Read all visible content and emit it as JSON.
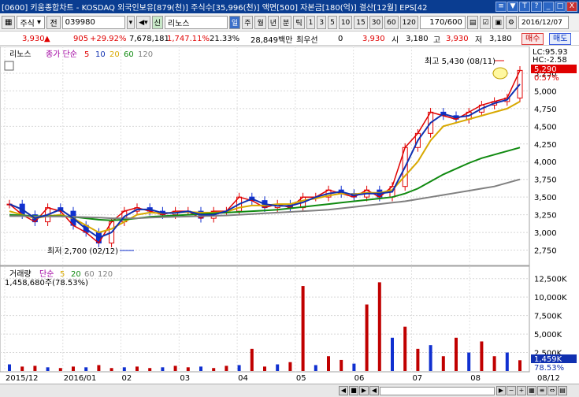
{
  "window": {
    "title": "[0600] 키움종합차트 - KOSDAQ 외국인보유[879(천)] 주식수[35,996(천)] 액면[500] 자본금[180(억)] 결산[12월] EPS[42",
    "buttons": [
      "≡",
      "▼",
      "T",
      "?",
      "_",
      "□",
      "X"
    ]
  },
  "toolbar": {
    "market": "주식",
    "prev_label": "전",
    "code": "039980",
    "stock_name": "리노스",
    "name_prefix": "신",
    "period_tabs": [
      "일",
      "주",
      "월",
      "년",
      "분",
      "틱"
    ],
    "selected_period": "일",
    "minute_options": [
      "1",
      "3",
      "5",
      "10",
      "15",
      "30",
      "60",
      "120"
    ],
    "count": "170",
    "count_total": "/600",
    "date": "2016/12/07"
  },
  "info": {
    "price": "3,930",
    "change": "905",
    "change_pct": "+29.92%",
    "volume": "7,678,181",
    "vol_pct": "1,747.11%",
    "turnover": "21.33%",
    "amount": "28,849백만",
    "min_label": "최우선",
    "min_val": "0",
    "cur": "3,930",
    "open_label": "시",
    "open": "3,180",
    "high_label": "고",
    "high": "3,930",
    "low_label": "저",
    "low": "3,180",
    "buy": "매수",
    "sell": "매도"
  },
  "price_panel": {
    "legend_name": "리노스",
    "legend_ma": "종가 단순",
    "ma_periods": [
      "5",
      "10",
      "20",
      "60",
      "120"
    ],
    "ma_colors": [
      "#e00000",
      "#1030b0",
      "#d8a800",
      "#108a10",
      "#808080"
    ],
    "lc": "LC:95.93",
    "hc": "HC:-2.58",
    "cur_price": "5,290",
    "cur_pct": "0.57%",
    "high_note": "최고 5,430 (08/11)",
    "low_note": "최저 2,700 (02/12)",
    "y_ticks": [
      "5,250",
      "5,000",
      "4,750",
      "4,500",
      "4,250",
      "4,000",
      "3,750",
      "3,500",
      "3,250",
      "3,000",
      "2,750"
    ]
  },
  "volume_panel": {
    "legend_name": "거래량",
    "legend_ma": "단순",
    "ma_periods": [
      "5",
      "20",
      "60",
      "120"
    ],
    "value_line": "1,458,680주(78.53%)",
    "cur_vol": "1,459K",
    "cur_pct": "78.53%",
    "y_ticks": [
      "12,500K",
      "10,000K",
      "7,500K",
      "5,000K",
      "2,500K"
    ]
  },
  "x_axis": {
    "labels": [
      "2015/12",
      "2016/01",
      "02",
      "03",
      "04",
      "05",
      "06",
      "07",
      "08"
    ],
    "end_label": "08/12"
  },
  "chart_data": {
    "type": "line",
    "title": "",
    "xlabel": "",
    "ylabel": "",
    "y_range": [
      2600,
      5450
    ],
    "series": [
      {
        "name": "5",
        "values": [
          3400,
          3250,
          3150,
          3350,
          3300,
          3100,
          3000,
          2850,
          3150,
          3300,
          3350,
          3300,
          3250,
          3300,
          3300,
          3200,
          3300,
          3300,
          3500,
          3450,
          3350,
          3400,
          3350,
          3500,
          3500,
          3600,
          3550,
          3500,
          3600,
          3500,
          3650,
          4200,
          4400,
          4700,
          4650,
          4600,
          4700,
          4800,
          4850,
          4900,
          5290
        ]
      },
      {
        "name": "20",
        "values": [
          3300,
          3250,
          3200,
          3230,
          3250,
          3200,
          3100,
          3000,
          3050,
          3150,
          3250,
          3280,
          3270,
          3280,
          3290,
          3280,
          3280,
          3290,
          3350,
          3380,
          3380,
          3400,
          3400,
          3450,
          3480,
          3520,
          3550,
          3540,
          3560,
          3560,
          3600,
          3800,
          4000,
          4300,
          4500,
          4550,
          4600,
          4650,
          4700,
          4750,
          4850
        ]
      },
      {
        "name": "60",
        "values": [
          3250,
          3240,
          3230,
          3230,
          3230,
          3220,
          3200,
          3180,
          3170,
          3180,
          3200,
          3220,
          3230,
          3240,
          3250,
          3260,
          3270,
          3280,
          3290,
          3300,
          3310,
          3320,
          3340,
          3360,
          3380,
          3400,
          3420,
          3440,
          3460,
          3480,
          3500,
          3550,
          3620,
          3720,
          3820,
          3900,
          3980,
          4050,
          4100,
          4150,
          4200
        ]
      },
      {
        "name": "120",
        "values": [
          3230,
          3230,
          3225,
          3225,
          3225,
          3220,
          3215,
          3210,
          3200,
          3200,
          3200,
          3210,
          3215,
          3220,
          3225,
          3230,
          3235,
          3240,
          3250,
          3260,
          3270,
          3280,
          3290,
          3300,
          3310,
          3320,
          3340,
          3360,
          3380,
          3400,
          3420,
          3440,
          3470,
          3500,
          3530,
          3560,
          3590,
          3620,
          3650,
          3700,
          3750
        ]
      }
    ],
    "volume_values": [
      900,
      600,
      700,
      500,
      400,
      600,
      500,
      800,
      400,
      500,
      600,
      400,
      500,
      700,
      500,
      600,
      400,
      700,
      800,
      3000,
      600,
      900,
      1200,
      11500,
      800,
      2000,
      1500,
      1000,
      9000,
      12000,
      4500,
      6000,
      3000,
      3500,
      2000,
      4500,
      2500,
      4000,
      2000,
      2500,
      1459
    ]
  }
}
